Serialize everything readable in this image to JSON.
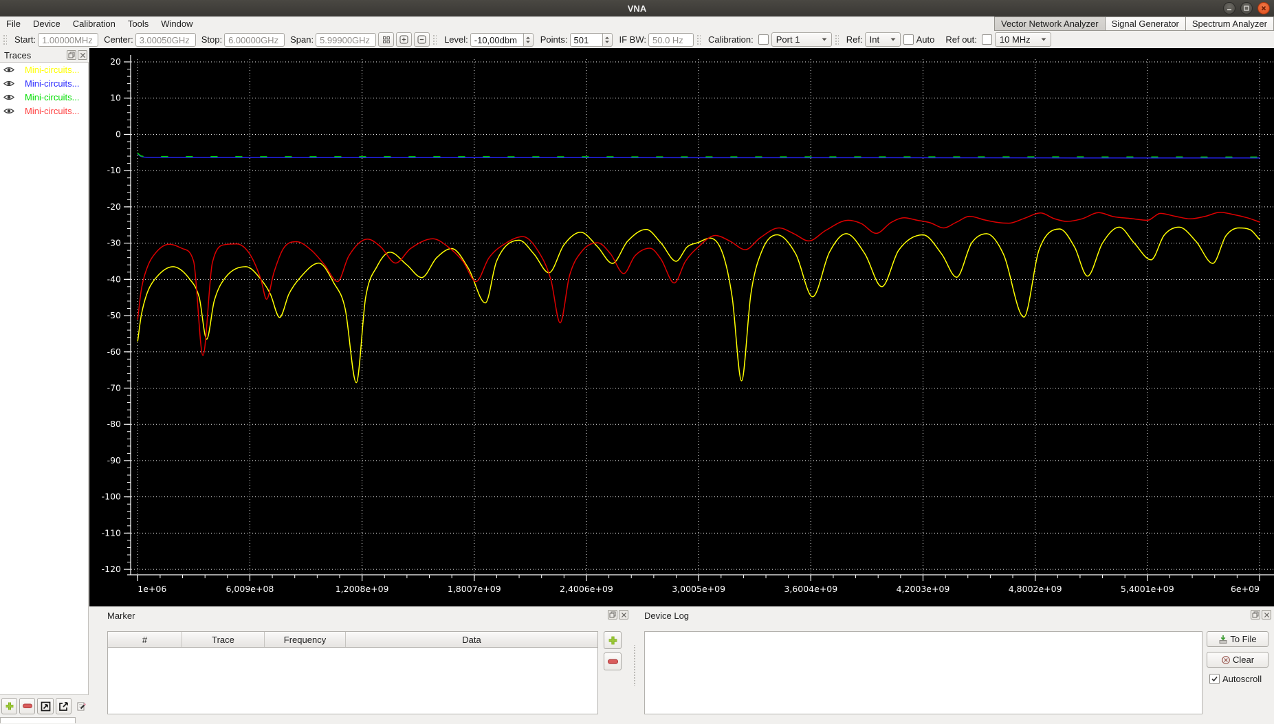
{
  "window": {
    "title": "VNA"
  },
  "menu": {
    "items": [
      "File",
      "Device",
      "Calibration",
      "Tools",
      "Window"
    ]
  },
  "mode_tabs": {
    "items": [
      {
        "label": "Vector Network Analyzer",
        "active": true
      },
      {
        "label": "Signal Generator",
        "active": false
      },
      {
        "label": "Spectrum Analyzer",
        "active": false
      }
    ]
  },
  "toolbar": {
    "start_label": "Start:",
    "start_value": "1.00000MHz",
    "center_label": "Center:",
    "center_value": "3.00050GHz",
    "stop_label": "Stop:",
    "stop_value": "6.00000GHz",
    "span_label": "Span:",
    "span_value": "5.99900GHz",
    "level_label": "Level:",
    "level_value": "-10,00dbm",
    "points_label": "Points:",
    "points_value": "501",
    "ifbw_label": "IF BW:",
    "ifbw_value": "50.0 Hz",
    "calibration_label": "Calibration:",
    "calibration_checked": false,
    "calibration_port": "Port 1",
    "ref_label": "Ref:",
    "ref_value": "Int",
    "auto_label": "Auto",
    "auto_checked": false,
    "refout_label": "Ref out:",
    "refout_checked": false,
    "refout_value": "10 MHz"
  },
  "traces_panel": {
    "title": "Traces",
    "items": [
      {
        "label": "Mini-circuits...",
        "color": "#ffff00"
      },
      {
        "label": "Mini-circuits...",
        "color": "#2a2aff"
      },
      {
        "label": "Mini-circuits...",
        "color": "#00dd00"
      },
      {
        "label": "Mini-circuits...",
        "color": "#ff4040"
      }
    ]
  },
  "marker_panel": {
    "title": "Marker",
    "columns": [
      "#",
      "Trace",
      "Frequency",
      "Data"
    ]
  },
  "device_log": {
    "title": "Device Log",
    "to_file_label": "To File",
    "clear_label": "Clear",
    "autoscroll_label": "Autoscroll",
    "autoscroll_checked": true
  },
  "chart_data": {
    "type": "line",
    "title": "",
    "xlabel": "",
    "ylabel": "",
    "x_unit": "GHz",
    "x_scale": "linear",
    "xlim_ghz": [
      0.001,
      6.0
    ],
    "ylim": [
      -120,
      20
    ],
    "grid": true,
    "legend_position": "none",
    "background": "#000000",
    "grid_color": "#ffffff",
    "y_ticks": [
      20,
      10,
      0,
      -10,
      -20,
      -30,
      -40,
      -50,
      -60,
      -70,
      -80,
      -90,
      -100,
      -110,
      -120
    ],
    "x_tick_freqs_ghz": [
      0.001,
      0.6009,
      1.2008,
      1.8007,
      2.4006,
      3.0005,
      3.6004,
      4.2003,
      4.8002,
      5.4001,
      6.0
    ],
    "x_tick_labels": [
      "1e+06",
      "6,009e+08",
      "1,2008e+09",
      "1,8007e+09",
      "2,4006e+09",
      "3,0005e+09",
      "3,6004e+09",
      "4,2003e+09",
      "4,8002e+09",
      "5,4001e+09",
      "6e+09"
    ],
    "series": [
      {
        "name": "Mini-circuits... (yellow, S21)",
        "color": "#ffff00",
        "dashed": false,
        "points": [
          [
            0.001,
            -57
          ],
          [
            0.02,
            -50
          ],
          [
            0.05,
            -44
          ],
          [
            0.1,
            -39.5
          ],
          [
            0.19,
            -36.5
          ],
          [
            0.28,
            -40
          ],
          [
            0.33,
            -45
          ],
          [
            0.37,
            -56.5
          ],
          [
            0.41,
            -46
          ],
          [
            0.47,
            -39.5
          ],
          [
            0.58,
            -36.5
          ],
          [
            0.66,
            -40
          ],
          [
            0.71,
            -44
          ],
          [
            0.76,
            -50.5
          ],
          [
            0.81,
            -44
          ],
          [
            0.87,
            -39.5
          ],
          [
            0.97,
            -35.5
          ],
          [
            1.05,
            -41
          ],
          [
            1.11,
            -48
          ],
          [
            1.17,
            -68.5
          ],
          [
            1.22,
            -45
          ],
          [
            1.28,
            -36.5
          ],
          [
            1.35,
            -32.5
          ],
          [
            1.44,
            -36
          ],
          [
            1.52,
            -39.5
          ],
          [
            1.6,
            -34
          ],
          [
            1.68,
            -31.5
          ],
          [
            1.77,
            -37
          ],
          [
            1.86,
            -46.5
          ],
          [
            1.92,
            -35
          ],
          [
            2.04,
            -29.2
          ],
          [
            2.12,
            -33
          ],
          [
            2.2,
            -38.2
          ],
          [
            2.28,
            -30.5
          ],
          [
            2.37,
            -27
          ],
          [
            2.46,
            -31
          ],
          [
            2.54,
            -35.6
          ],
          [
            2.62,
            -29.5
          ],
          [
            2.72,
            -26.2
          ],
          [
            2.8,
            -30
          ],
          [
            2.88,
            -35
          ],
          [
            2.94,
            -31
          ],
          [
            3.0,
            -29.8
          ],
          [
            3.06,
            -28.6
          ],
          [
            3.13,
            -33
          ],
          [
            3.18,
            -45
          ],
          [
            3.23,
            -68
          ],
          [
            3.28,
            -44
          ],
          [
            3.34,
            -32
          ],
          [
            3.42,
            -27.7
          ],
          [
            3.52,
            -33
          ],
          [
            3.61,
            -44.8
          ],
          [
            3.7,
            -32.5
          ],
          [
            3.79,
            -27.4
          ],
          [
            3.89,
            -33
          ],
          [
            3.98,
            -42
          ],
          [
            4.07,
            -32
          ],
          [
            4.2,
            -27.7
          ],
          [
            4.3,
            -33
          ],
          [
            4.38,
            -39.4
          ],
          [
            4.46,
            -30
          ],
          [
            4.54,
            -27.4
          ],
          [
            4.63,
            -33
          ],
          [
            4.74,
            -50.4
          ],
          [
            4.82,
            -32
          ],
          [
            4.93,
            -26.1
          ],
          [
            5.01,
            -31
          ],
          [
            5.08,
            -39.1
          ],
          [
            5.16,
            -30
          ],
          [
            5.25,
            -25.6
          ],
          [
            5.33,
            -30
          ],
          [
            5.42,
            -34.6
          ],
          [
            5.49,
            -27.8
          ],
          [
            5.57,
            -25.6
          ],
          [
            5.66,
            -29.5
          ],
          [
            5.75,
            -35.6
          ],
          [
            5.82,
            -28
          ],
          [
            5.89,
            -25.8
          ],
          [
            5.95,
            -26.3
          ],
          [
            6.0,
            -29
          ]
        ]
      },
      {
        "name": "Mini-circuits... (blue, S11 thru)",
        "color": "#2222ee",
        "dashed": false,
        "points": [
          [
            0.001,
            -5.4
          ],
          [
            0.02,
            -6.1
          ],
          [
            0.06,
            -6.35
          ],
          [
            1.0,
            -6.4
          ],
          [
            2.0,
            -6.4
          ],
          [
            3.0,
            -6.45
          ],
          [
            4.0,
            -6.45
          ],
          [
            5.0,
            -6.5
          ],
          [
            6.0,
            -6.5
          ]
        ]
      },
      {
        "name": "Mini-circuits... (green)",
        "color": "#00d200",
        "dashed": true,
        "points": [
          [
            0.001,
            -5.2
          ],
          [
            0.02,
            -5.95
          ],
          [
            0.06,
            -6.1
          ],
          [
            1.5,
            -6.15
          ],
          [
            3.0,
            -6.2
          ],
          [
            4.5,
            -6.2
          ],
          [
            6.0,
            -6.25
          ]
        ]
      },
      {
        "name": "Mini-circuits... (red)",
        "color": "#dd0000",
        "dashed": false,
        "points": [
          [
            0.001,
            -51
          ],
          [
            0.02,
            -43
          ],
          [
            0.05,
            -37
          ],
          [
            0.1,
            -32.5
          ],
          [
            0.17,
            -30.3
          ],
          [
            0.24,
            -31.5
          ],
          [
            0.3,
            -35
          ],
          [
            0.35,
            -61
          ],
          [
            0.4,
            -35.5
          ],
          [
            0.47,
            -30.4
          ],
          [
            0.53,
            -30.2
          ],
          [
            0.6,
            -33
          ],
          [
            0.66,
            -40
          ],
          [
            0.69,
            -45.5
          ],
          [
            0.73,
            -38
          ],
          [
            0.78,
            -31.5
          ],
          [
            0.85,
            -29.6
          ],
          [
            0.93,
            -32
          ],
          [
            1.0,
            -36
          ],
          [
            1.07,
            -40.6
          ],
          [
            1.13,
            -33.5
          ],
          [
            1.23,
            -28.9
          ],
          [
            1.3,
            -31
          ],
          [
            1.38,
            -35.5
          ],
          [
            1.46,
            -31.5
          ],
          [
            1.58,
            -28.8
          ],
          [
            1.66,
            -31
          ],
          [
            1.74,
            -35
          ],
          [
            1.81,
            -40.6
          ],
          [
            1.88,
            -34
          ],
          [
            1.97,
            -30
          ],
          [
            2.06,
            -28.2
          ],
          [
            2.14,
            -32
          ],
          [
            2.21,
            -40
          ],
          [
            2.26,
            -52
          ],
          [
            2.31,
            -39
          ],
          [
            2.38,
            -32
          ],
          [
            2.46,
            -29.9
          ],
          [
            2.53,
            -33
          ],
          [
            2.6,
            -38.4
          ],
          [
            2.66,
            -33.5
          ],
          [
            2.74,
            -31.4
          ],
          [
            2.8,
            -34.5
          ],
          [
            2.87,
            -41
          ],
          [
            2.93,
            -35
          ],
          [
            3.0,
            -31
          ],
          [
            3.09,
            -27.9
          ],
          [
            3.17,
            -29.5
          ],
          [
            3.25,
            -31.8
          ],
          [
            3.33,
            -28.5
          ],
          [
            3.43,
            -25.8
          ],
          [
            3.51,
            -27.4
          ],
          [
            3.59,
            -29.4
          ],
          [
            3.68,
            -26.5
          ],
          [
            3.8,
            -23.7
          ],
          [
            3.87,
            -24.6
          ],
          [
            3.95,
            -27.3
          ],
          [
            4.03,
            -24.3
          ],
          [
            4.1,
            -23.0
          ],
          [
            4.17,
            -23.7
          ],
          [
            4.24,
            -24.4
          ],
          [
            4.31,
            -25.8
          ],
          [
            4.38,
            -24.2
          ],
          [
            4.45,
            -22.6
          ],
          [
            4.53,
            -23.6
          ],
          [
            4.6,
            -24.3
          ],
          [
            4.66,
            -24.5
          ],
          [
            4.74,
            -23.2
          ],
          [
            4.83,
            -21.7
          ],
          [
            4.9,
            -23.2
          ],
          [
            4.97,
            -24.0
          ],
          [
            5.05,
            -23.3
          ],
          [
            5.14,
            -21.6
          ],
          [
            5.22,
            -22.7
          ],
          [
            5.31,
            -23.2
          ],
          [
            5.4,
            -23.7
          ],
          [
            5.47,
            -21.8
          ],
          [
            5.55,
            -22.6
          ],
          [
            5.63,
            -23.3
          ],
          [
            5.71,
            -22.6
          ],
          [
            5.79,
            -21.5
          ],
          [
            5.86,
            -22.1
          ],
          [
            5.94,
            -23.1
          ],
          [
            6.0,
            -24.2
          ]
        ]
      }
    ]
  }
}
